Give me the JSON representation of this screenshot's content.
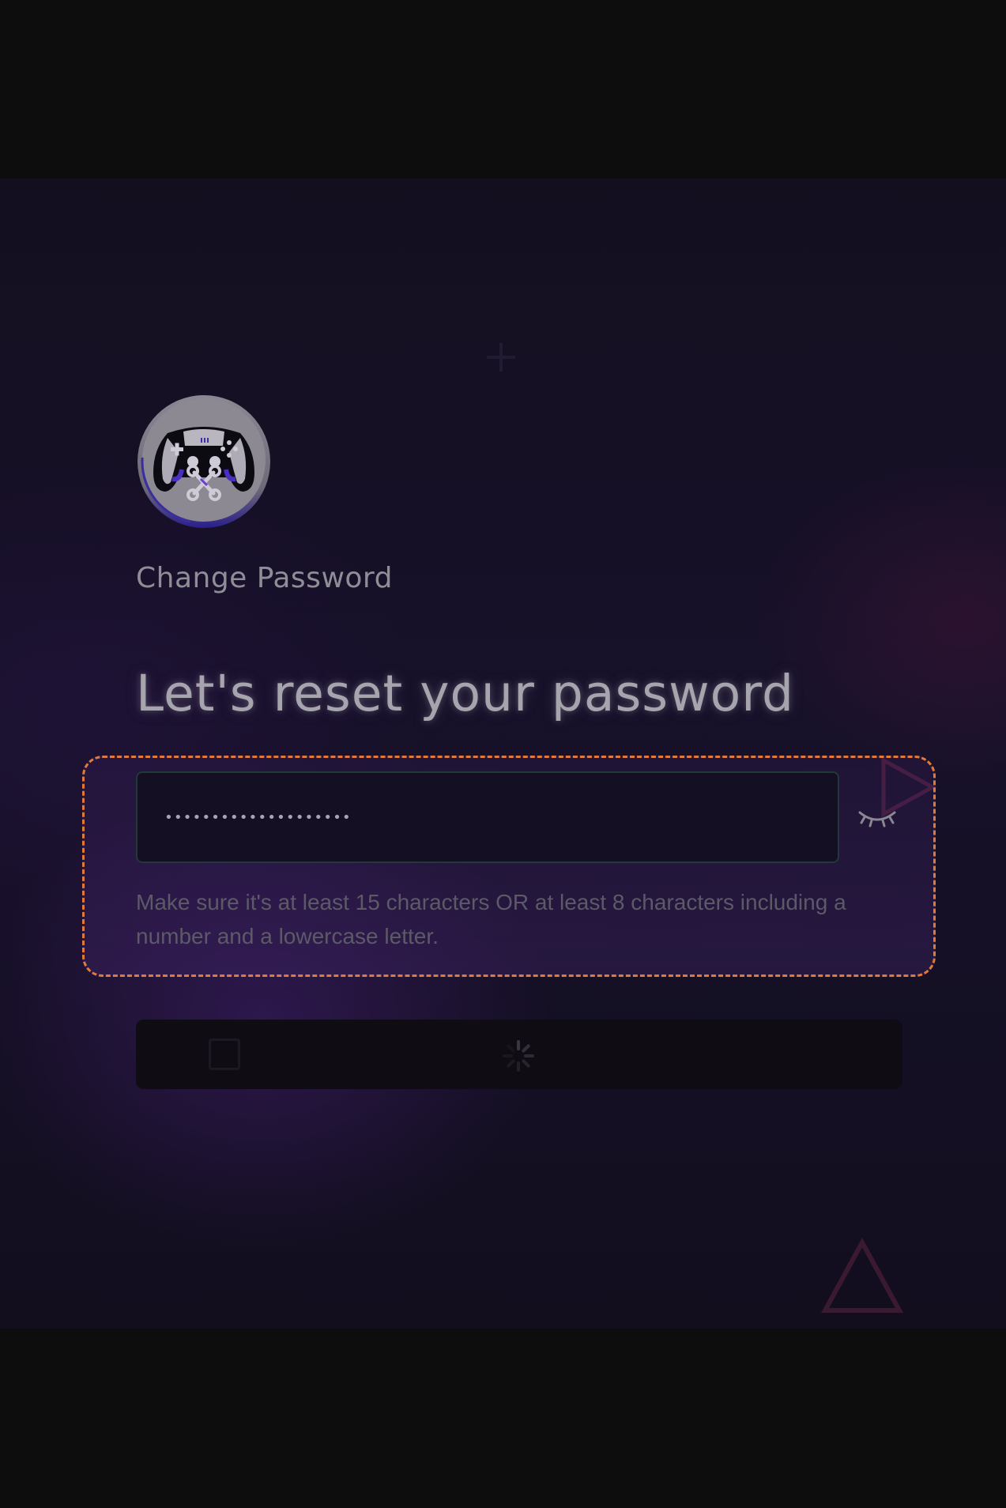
{
  "page": {
    "section_label": "Change Password",
    "heading": "Let's reset your password"
  },
  "password_field": {
    "value": "••••••••••••••••••••",
    "visibility_toggle_icon": "eye-closed-icon"
  },
  "hint": {
    "text": "Make sure it's at least 15 characters OR at least 8 characters including a number and a lowercase letter."
  },
  "submit_button": {
    "state": "loading",
    "icon": "spinner-icon"
  },
  "logo": {
    "icon": "gamepad-wrench-logo"
  },
  "colors": {
    "background": "#0d0d0e",
    "panel": "#17112a",
    "highlight_border": "#e07a3a",
    "input_border": "#1f3a38",
    "text_muted": "#5d5a68",
    "accent": "#4b2fa8"
  }
}
